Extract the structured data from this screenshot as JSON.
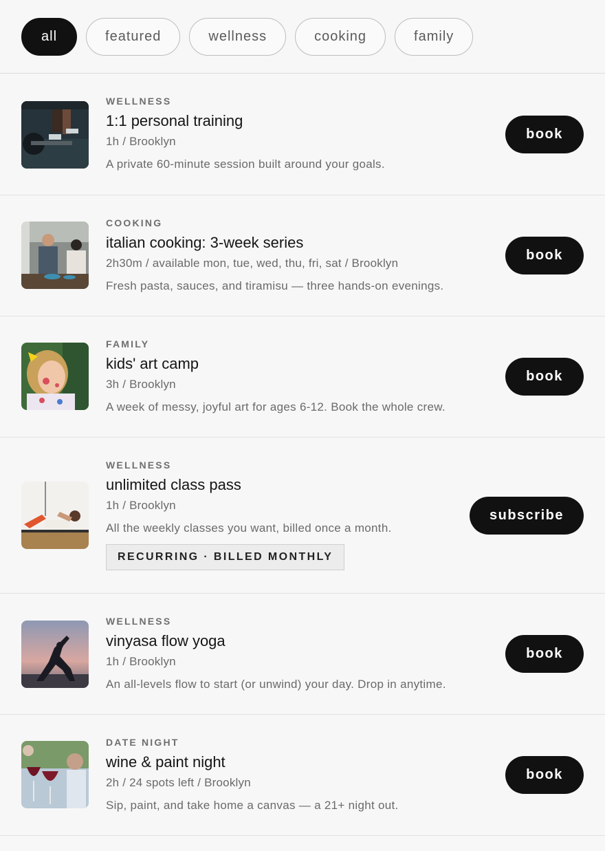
{
  "filters": {
    "items": [
      {
        "label": "all",
        "active": true
      },
      {
        "label": "featured",
        "active": false
      },
      {
        "label": "wellness",
        "active": false
      },
      {
        "label": "cooking",
        "active": false
      },
      {
        "label": "family",
        "active": false
      }
    ]
  },
  "listings": [
    {
      "category": "WELLNESS",
      "title": "1:1 personal training",
      "meta": "1h / Brooklyn",
      "description": "A private 60-minute session built around your goals.",
      "cta": "book",
      "image": "personal-training-photo"
    },
    {
      "category": "COOKING",
      "title": "italian cooking: 3-week series",
      "meta": "2h30m / available mon, tue, wed, thu, fri, sat / Brooklyn",
      "description": "Fresh pasta, sauces, and tiramisu — three hands-on evenings.",
      "cta": "book",
      "image": "cooking-class-photo"
    },
    {
      "category": "FAMILY",
      "title": "kids' art camp",
      "meta": "3h / Brooklyn",
      "description": "A week of messy, joyful art for ages 6-12. Book the whole crew.",
      "cta": "book",
      "image": "kids-art-photo"
    },
    {
      "category": "WELLNESS",
      "title": "unlimited class pass",
      "meta": "1h / Brooklyn",
      "description": "All the weekly classes you want, billed once a month.",
      "tag": "RECURRING · BILLED MONTHLY",
      "cta": "subscribe",
      "image": "class-pass-photo"
    },
    {
      "category": "WELLNESS",
      "title": "vinyasa flow yoga",
      "meta": "1h / Brooklyn",
      "description": "An all-levels flow to start (or unwind) your day. Drop in anytime.",
      "cta": "book",
      "image": "yoga-photo"
    },
    {
      "category": "DATE NIGHT",
      "title": "wine & paint night",
      "meta": "2h / 24 spots left / Brooklyn",
      "description": "Sip, paint, and take home a canvas — a 21+ night out.",
      "cta": "book",
      "image": "wine-paint-photo"
    }
  ]
}
